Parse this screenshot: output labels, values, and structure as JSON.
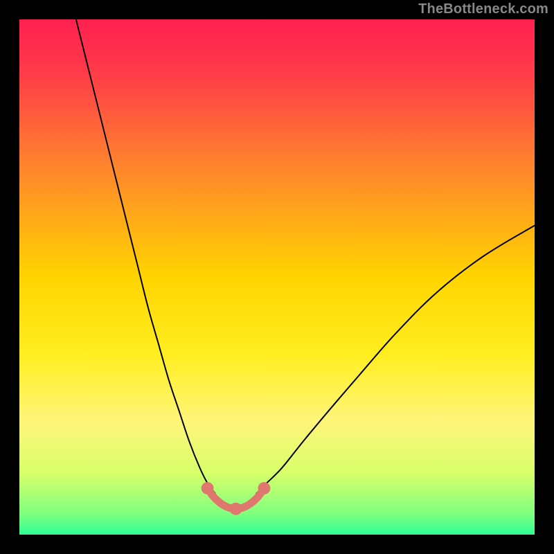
{
  "watermark": "TheBottleneck.com",
  "chart_data": {
    "type": "line",
    "title": "",
    "xlabel": "",
    "ylabel": "",
    "xlim": [
      0,
      100
    ],
    "ylim": [
      0,
      100
    ],
    "grid": false,
    "legend": false,
    "background_gradient": {
      "stops": [
        {
          "offset": 0.0,
          "color": "#ff2050"
        },
        {
          "offset": 0.1,
          "color": "#ff3a4a"
        },
        {
          "offset": 0.3,
          "color": "#ff8a2a"
        },
        {
          "offset": 0.5,
          "color": "#ffd400"
        },
        {
          "offset": 0.65,
          "color": "#ffee20"
        },
        {
          "offset": 0.78,
          "color": "#fff57a"
        },
        {
          "offset": 0.88,
          "color": "#d8ff6a"
        },
        {
          "offset": 0.96,
          "color": "#7fff7f"
        },
        {
          "offset": 1.0,
          "color": "#2dff95"
        }
      ]
    },
    "series": [
      {
        "name": "left-branch",
        "color": "#000000",
        "x": [
          11,
          13,
          15,
          17,
          19,
          21,
          23,
          25,
          27,
          29,
          31,
          33,
          35,
          36.5,
          38
        ],
        "y": [
          100,
          92,
          84,
          76,
          68,
          60,
          52,
          44,
          37,
          30,
          24,
          18,
          13,
          10,
          8
        ]
      },
      {
        "name": "right-branch",
        "color": "#000000",
        "x": [
          46,
          48,
          51,
          55,
          60,
          66,
          73,
          81,
          90,
          100
        ],
        "y": [
          8,
          10,
          13,
          18,
          24,
          31,
          39,
          47,
          54,
          60
        ]
      },
      {
        "name": "valley-highlight",
        "color": "#e0776f",
        "x": [
          36.5,
          38,
          40,
          42,
          44,
          46,
          47.5
        ],
        "y": [
          9,
          7,
          5.5,
          5,
          5.5,
          7,
          9
        ]
      }
    ],
    "markers": [
      {
        "name": "left-cap",
        "x": 36.5,
        "y": 9,
        "r": 1.2,
        "color": "#e0776f"
      },
      {
        "name": "right-cap",
        "x": 47.5,
        "y": 9,
        "r": 1.2,
        "color": "#e0776f"
      },
      {
        "name": "bottom-dot",
        "x": 42,
        "y": 5,
        "r": 1.2,
        "color": "#e0776f"
      }
    ]
  }
}
